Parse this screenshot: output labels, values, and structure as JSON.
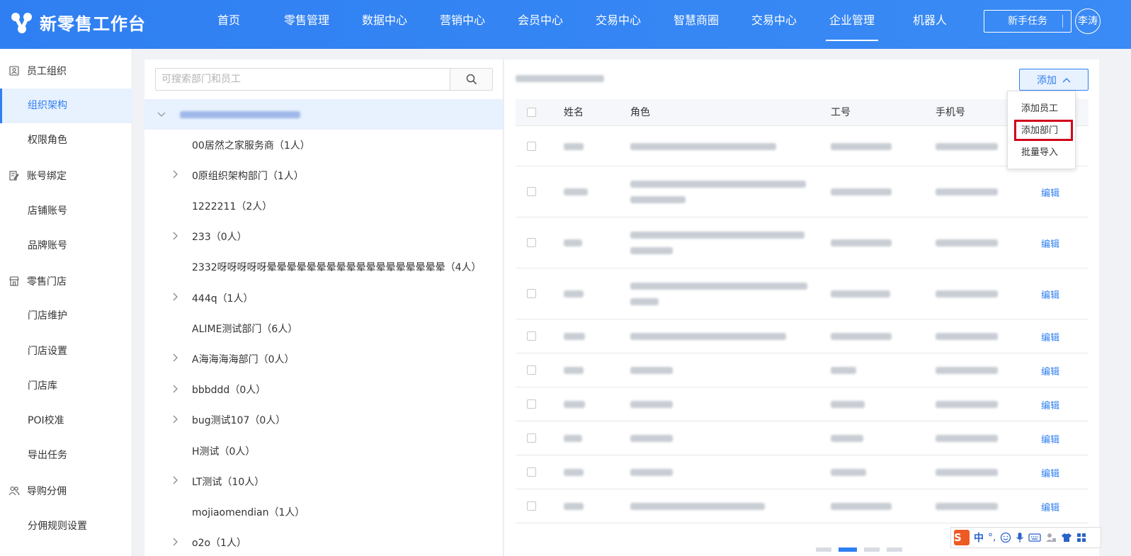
{
  "app": {
    "title": "新零售工作台"
  },
  "nav": {
    "items": [
      "首页",
      "零售管理",
      "数据中心",
      "营销中心",
      "会员中心",
      "交易中心",
      "智慧商圈",
      "交易中心",
      "企业管理",
      "机器人"
    ],
    "active_index": 8
  },
  "header": {
    "newbie_task": "新手任务",
    "user": "李涛"
  },
  "sidebar": {
    "groups": [
      {
        "label": "员工组织",
        "icon": "person-card-icon",
        "items": [
          "组织架构",
          "权限角色"
        ]
      },
      {
        "label": "账号绑定",
        "icon": "edit-doc-icon",
        "items": [
          "店铺账号",
          "品牌账号"
        ]
      },
      {
        "label": "零售门店",
        "icon": "store-icon",
        "items": [
          "门店维护",
          "门店设置",
          "门店库",
          "POI校准",
          "导出任务"
        ]
      },
      {
        "label": "导购分佣",
        "icon": "people-icon",
        "items": [
          "分佣规则设置"
        ]
      }
    ],
    "active": "组织架构"
  },
  "tree": {
    "search_placeholder": "可搜索部门和员工",
    "nodes": [
      {
        "label": "00居然之家服务商（1人）",
        "expandable": false
      },
      {
        "label": "0原组织架构部门（1人）",
        "expandable": true
      },
      {
        "label": "1222211（2人）",
        "expandable": false
      },
      {
        "label": "233（0人）",
        "expandable": true
      },
      {
        "label": "2332呀呀呀呀呀晕晕晕晕晕晕晕晕晕晕晕晕晕晕晕晕晕晕（4人）",
        "expandable": false
      },
      {
        "label": "444q（1人）",
        "expandable": true
      },
      {
        "label": "ALIME测试部门（6人）",
        "expandable": false
      },
      {
        "label": "A海海海海部门（0人）",
        "expandable": true
      },
      {
        "label": "bbbddd（0人）",
        "expandable": true
      },
      {
        "label": "bug测试107（0人）",
        "expandable": true
      },
      {
        "label": "H测试（0人）",
        "expandable": false
      },
      {
        "label": "LT测试（10人）",
        "expandable": true
      },
      {
        "label": "mojiaomendian（1人）",
        "expandable": false
      },
      {
        "label": "o2o（1人）",
        "expandable": true
      }
    ]
  },
  "table": {
    "add_button": "添加",
    "columns": [
      "姓名",
      "角色",
      "工号",
      "手机号"
    ],
    "edit_label": "编辑",
    "row_count": 10
  },
  "add_menu": {
    "items": [
      "添加员工",
      "添加部门",
      "批量导入"
    ],
    "highlighted": "添加部门"
  },
  "ime": {
    "mode": "中",
    "punct": "°,"
  },
  "colors": {
    "primary": "#2f7ff2",
    "highlight_border": "#d0021b",
    "active_bg": "#e8f1fe"
  }
}
